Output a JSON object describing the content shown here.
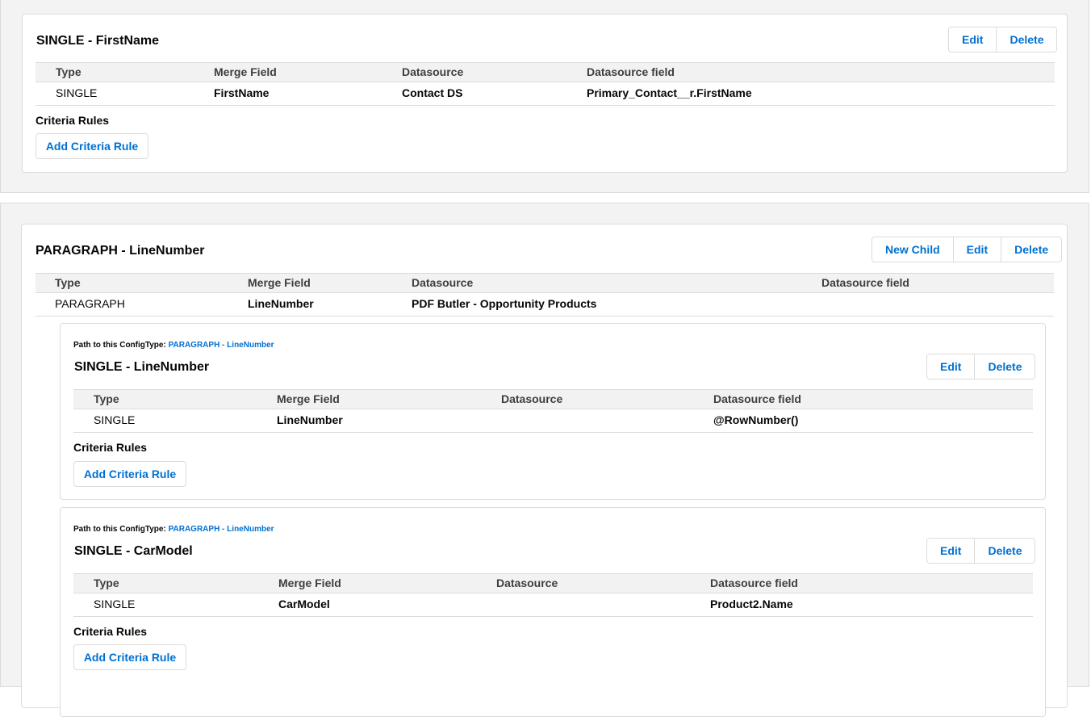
{
  "cards": {
    "first_name": {
      "title": "SINGLE - FirstName",
      "buttons": {
        "edit": "Edit",
        "delete": "Delete"
      },
      "columns": [
        "Type",
        "Merge Field",
        "Datasource",
        "Datasource field"
      ],
      "row": [
        "SINGLE",
        "FirstName",
        "Contact DS",
        "Primary_Contact__r.FirstName"
      ],
      "criteria_label": "Criteria Rules",
      "add_criteria": "Add Criteria Rule"
    },
    "paragraph": {
      "title": "PARAGRAPH - LineNumber",
      "buttons": {
        "new_child": "New Child",
        "edit": "Edit",
        "delete": "Delete"
      },
      "columns": [
        "Type",
        "Merge Field",
        "Datasource",
        "Datasource field"
      ],
      "row": [
        "PARAGRAPH",
        "LineNumber",
        "PDF Butler - Opportunity Products",
        ""
      ]
    },
    "child_line_number": {
      "path_prefix": "Path to this ConfigType:",
      "path_link": "PARAGRAPH - LineNumber",
      "title": "SINGLE - LineNumber",
      "buttons": {
        "edit": "Edit",
        "delete": "Delete"
      },
      "columns": [
        "Type",
        "Merge Field",
        "Datasource",
        "Datasource field"
      ],
      "row": [
        "SINGLE",
        "LineNumber",
        "",
        "@RowNumber()"
      ],
      "criteria_label": "Criteria Rules",
      "add_criteria": "Add Criteria Rule"
    },
    "child_car_model": {
      "path_prefix": "Path to this ConfigType:",
      "path_link": "PARAGRAPH - LineNumber",
      "title": "SINGLE - CarModel",
      "buttons": {
        "edit": "Edit",
        "delete": "Delete"
      },
      "columns": [
        "Type",
        "Merge Field",
        "Datasource",
        "Datasource field"
      ],
      "row": [
        "SINGLE",
        "CarModel",
        "",
        "Product2.Name"
      ],
      "criteria_label": "Criteria Rules",
      "add_criteria": "Add Criteria Rule"
    }
  }
}
